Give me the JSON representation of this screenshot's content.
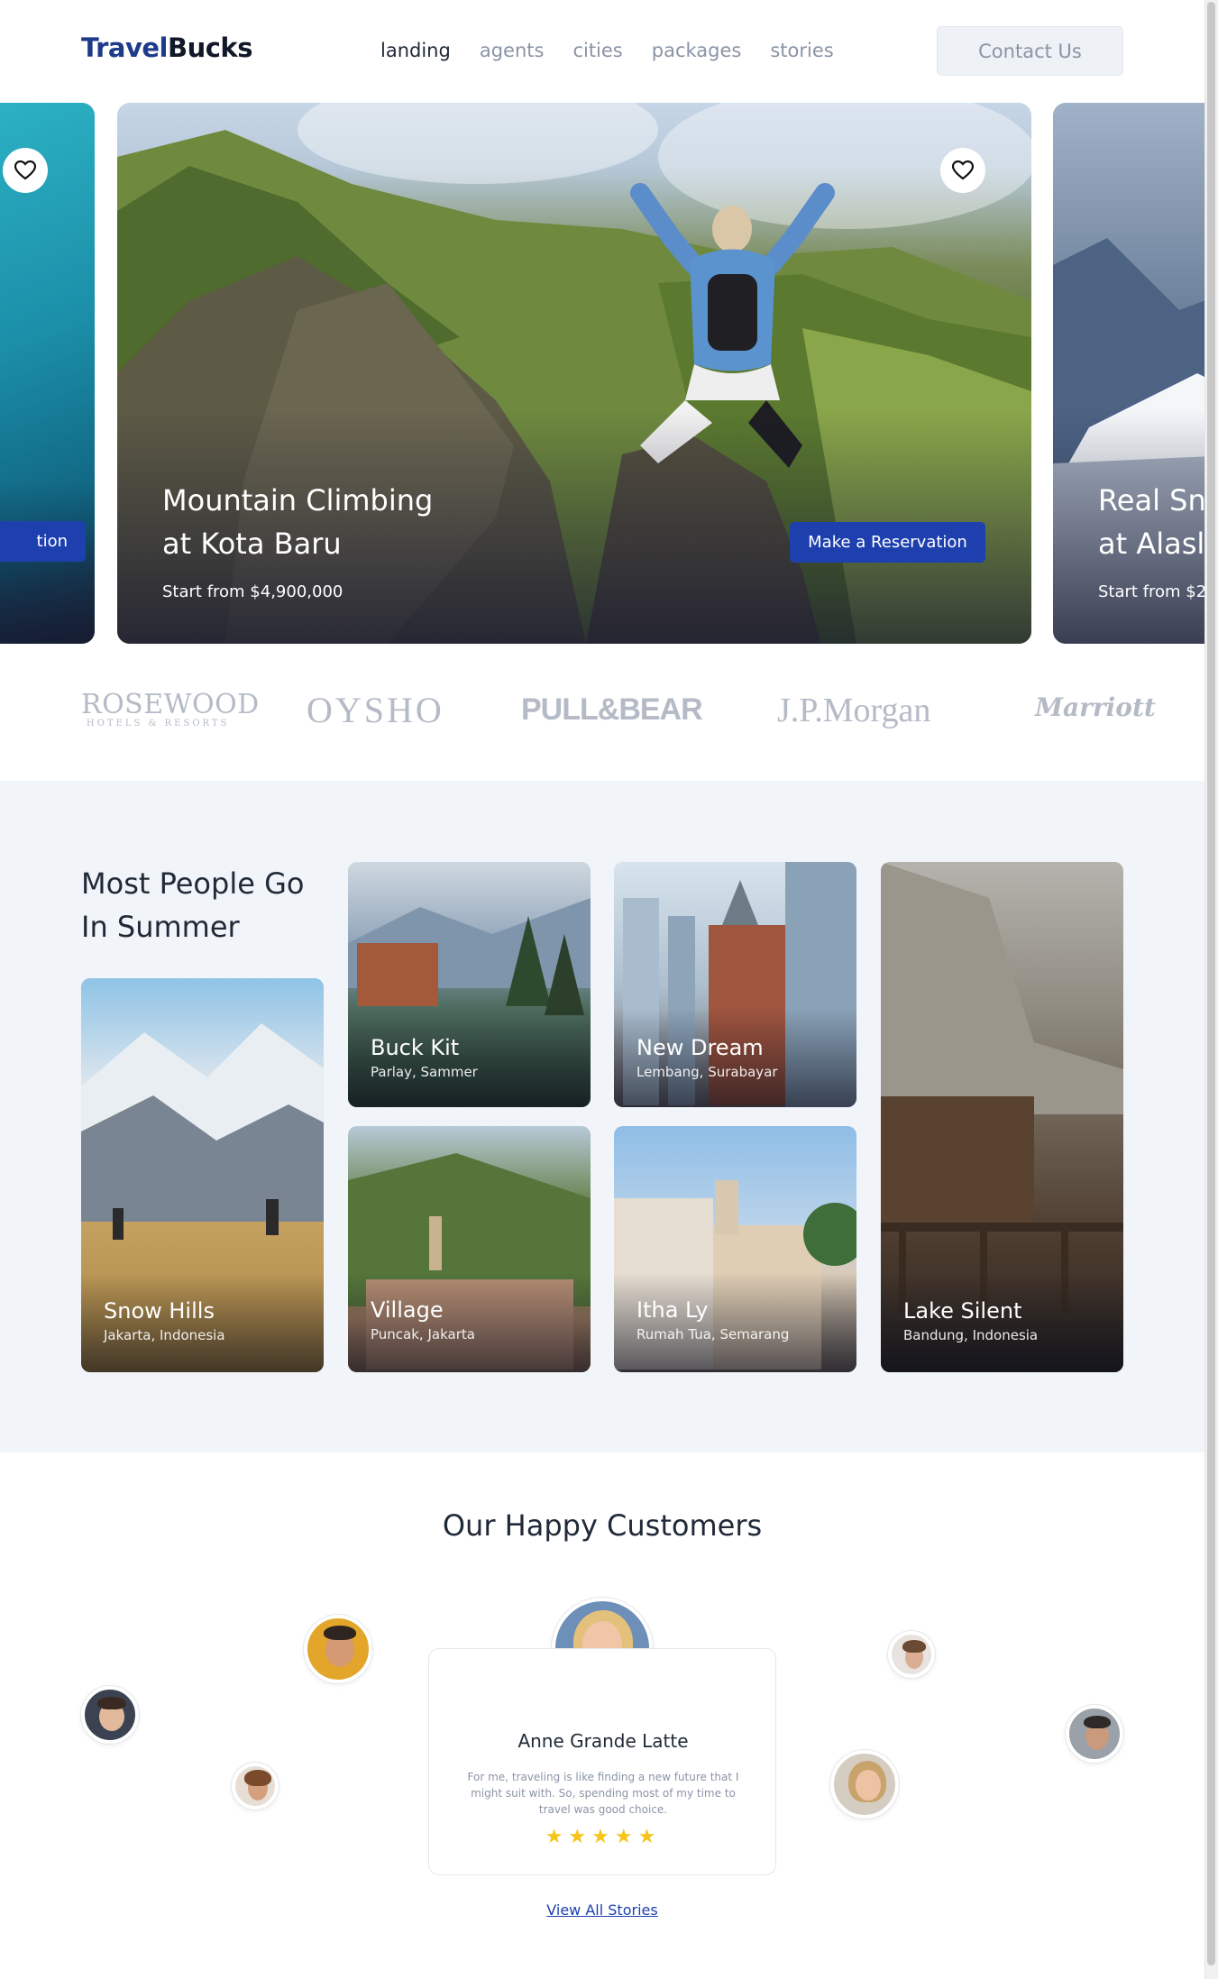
{
  "header": {
    "logo_part1": "Travel",
    "logo_part2": "Bucks",
    "nav": [
      "landing",
      "agents",
      "cities",
      "packages",
      "stories"
    ],
    "active_nav": "landing",
    "contact_label": "Contact Us"
  },
  "hero": {
    "left_slide": {
      "button_label": "tion"
    },
    "center_slide": {
      "title_line1": "Mountain Climbing",
      "title_line2": "at Kota Baru",
      "price": "Start from $4,900,000",
      "button_label": "Make a Reservation"
    },
    "right_slide": {
      "title_line1": "Real Sn",
      "title_line2": "at Alasl",
      "price": "Start from $2"
    }
  },
  "brands": {
    "rosewood": "ROSEWOOD",
    "rosewood_sub": "HOTELS & RESORTS",
    "oysho": "OYSHO",
    "pullbear": "PULL&BEAR",
    "jpmorgan": "J.P.Morgan",
    "marriott": "Marriott"
  },
  "summer": {
    "title_line1": "Most People Go",
    "title_line2": "In Summer",
    "cards": [
      {
        "name": "Snow Hills",
        "location": "Jakarta, Indonesia"
      },
      {
        "name": "Buck Kit",
        "location": "Parlay, Sammer"
      },
      {
        "name": "New Dream",
        "location": "Lembang, Surabayar"
      },
      {
        "name": "Village",
        "location": "Puncak, Jakarta"
      },
      {
        "name": "Itha Ly",
        "location": "Rumah Tua, Semarang"
      },
      {
        "name": "Lake Silent",
        "location": "Bandung, Indonesia"
      }
    ]
  },
  "customers": {
    "title": "Our Happy Customers",
    "featured": {
      "name": "Anne Grande Latte",
      "quote": "For me, traveling is like finding a new future that I might suit with. So, spending most of my time to travel was good choice.",
      "stars": "★★★★★",
      "rating": 5
    },
    "view_all_label": "View All Stories"
  },
  "colors": {
    "brand_blue": "#1e40af",
    "logo_blue": "#1e3a8a",
    "section_bg": "#f1f4f8",
    "star": "#f5c518"
  },
  "icons": [
    "heart-icon",
    "star-icon"
  ]
}
